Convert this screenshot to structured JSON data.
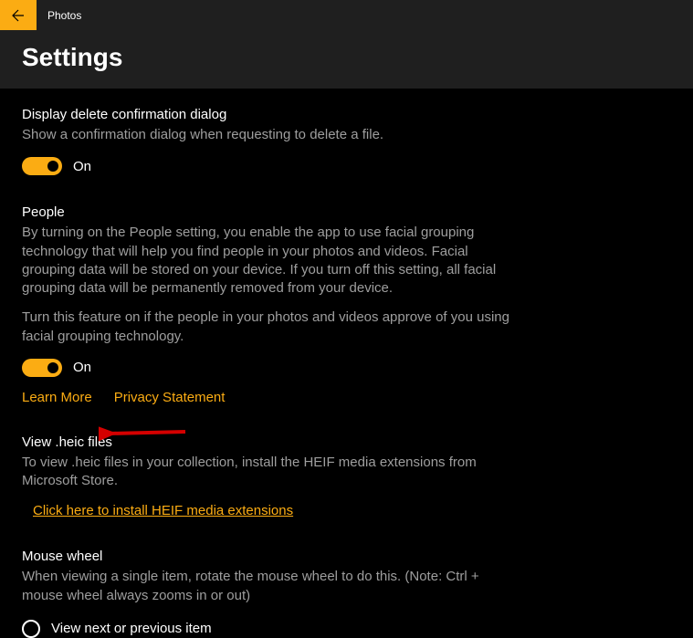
{
  "app": {
    "title": "Photos"
  },
  "page": {
    "heading": "Settings"
  },
  "sections": {
    "delete_confirm": {
      "title": "Display delete confirmation dialog",
      "desc": "Show a confirmation dialog when requesting to delete a file.",
      "toggle_state": "On"
    },
    "people": {
      "title": "People",
      "desc1": "By turning on the People setting, you enable the app to use facial grouping technology that will help you find people in your photos and videos. Facial grouping data will be stored on your device. If you turn off this setting, all facial grouping data will be permanently removed from your device.",
      "desc2": "Turn this feature on if the people in your photos and videos approve of you using facial grouping technology.",
      "toggle_state": "On",
      "learn_more": "Learn More",
      "privacy": "Privacy Statement"
    },
    "heic": {
      "title": "View .heic files",
      "desc": "To view .heic files in your collection, install the HEIF media extensions from Microsoft Store.",
      "link": "Click here to install HEIF media extensions"
    },
    "mouse": {
      "title": "Mouse wheel",
      "desc": "When viewing a single item, rotate the mouse wheel to do this. (Note: Ctrl + mouse wheel always zooms in or out)",
      "option1": "View next or previous item"
    }
  },
  "colors": {
    "accent": "#fbac13"
  }
}
